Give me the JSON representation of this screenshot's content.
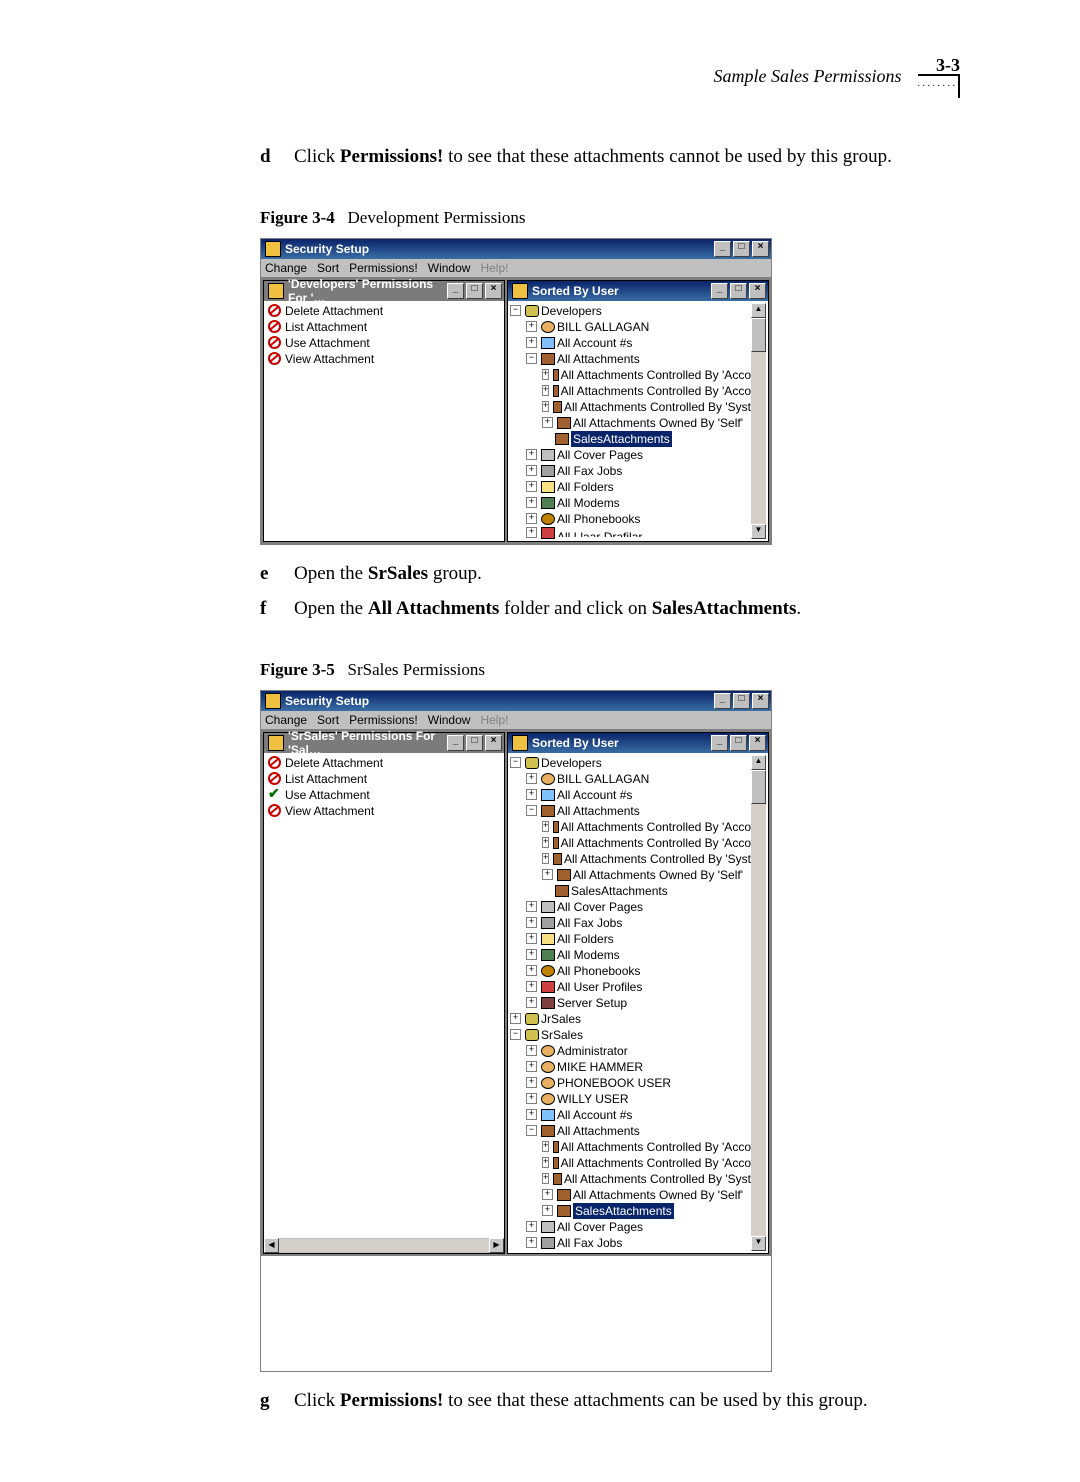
{
  "header": {
    "title": "Sample Sales Permissions",
    "page": "3-3",
    "ornament": ". . . . . . . ."
  },
  "steps": {
    "d": {
      "label": "d",
      "pre": "Click ",
      "b1": "Permissions!",
      "post": " to see that these attachments cannot be used by this group."
    },
    "e": {
      "label": "e",
      "pre": "Open the ",
      "b1": "SrSales",
      "post": " group."
    },
    "f": {
      "label": "f",
      "pre": "Open the ",
      "b1": "All Attachments",
      "mid": " folder and click on ",
      "b2": "SalesAttachments",
      "post": "."
    },
    "g": {
      "label": "g",
      "pre": "Click ",
      "b1": "Permissions!",
      "post": " to see that these attachments can be used by this group."
    }
  },
  "fig4": {
    "caption_b": "Figure 3-4",
    "caption_rest": "Development Permissions",
    "app_title": "Security Setup",
    "menus": {
      "change": "Change",
      "sort": "Sort",
      "perm": "Permissions!",
      "window": "Window",
      "help": "Help!"
    },
    "left_title": "'Developers' Permissions For '…",
    "right_title": "Sorted By User",
    "perms": {
      "delete": "Delete Attachment",
      "list": "List Attachment",
      "use": "Use Attachment",
      "view": "View Attachment"
    },
    "tree": {
      "developers": "Developers",
      "bill": "BILL GALLAGAN",
      "acct": "All Account #s",
      "allatt": "All Attachments",
      "att_acc1": "All Attachments Controlled By 'Acco",
      "att_acc2": "All Attachments Controlled By 'Acco",
      "att_syst": "All Attachments Controlled By 'Syst",
      "att_self": "All Attachments Owned By 'Self'",
      "sales": "SalesAttachments",
      "cover": "All Cover Pages",
      "fax": "All Fax Jobs",
      "folders": "All Folders",
      "modems": "All Modems",
      "phone": "All Phonebooks",
      "partial": "All Llaar Drafilar"
    }
  },
  "fig5": {
    "caption_b": "Figure 3-5",
    "caption_rest": "SrSales Permissions",
    "app_title": "Security Setup",
    "menus": {
      "change": "Change",
      "sort": "Sort",
      "perm": "Permissions!",
      "window": "Window",
      "help": "Help!"
    },
    "left_title": "'SrSales' Permissions For 'Sal…",
    "right_title": "Sorted By User",
    "perms": {
      "delete": "Delete Attachment",
      "list": "List Attachment",
      "use": "Use Attachment",
      "view": "View Attachment"
    },
    "tree": {
      "developers": "Developers",
      "bill": "BILL GALLAGAN",
      "acct": "All Account #s",
      "allatt": "All Attachments",
      "att_acc1": "All Attachments Controlled By 'Acco",
      "att_acc2": "All Attachments Controlled By 'Acco",
      "att_syst": "All Attachments Controlled By 'Syst",
      "att_self": "All Attachments Owned By 'Self'",
      "sales": "SalesAttachments",
      "cover": "All Cover Pages",
      "fax": "All Fax Jobs",
      "folders": "All Folders",
      "modems": "All Modems",
      "phone": "All Phonebooks",
      "profiles": "All User Profiles",
      "server": "Server Setup",
      "jrsales": "JrSales",
      "srsales": "SrSales",
      "admin": "Administrator",
      "mike": "MIKE HAMMER",
      "pbuser": "PHONEBOOK USER",
      "willy": "WILLY USER",
      "sr_acct": "All Account #s",
      "sr_allatt": "All Attachments",
      "sr_att_acc1": "All Attachments Controlled By 'Acco",
      "sr_att_acc2": "All Attachments Controlled By 'Acco",
      "sr_att_syst": "All Attachments Controlled By 'Syst",
      "sr_att_self": "All Attachments Owned By 'Self'",
      "sr_sales": "SalesAttachments",
      "sr_cover": "All Cover Pages",
      "sr_fax": "All Fax Jobs"
    }
  },
  "wc": {
    "min": "_",
    "max": "□",
    "close": "×"
  }
}
